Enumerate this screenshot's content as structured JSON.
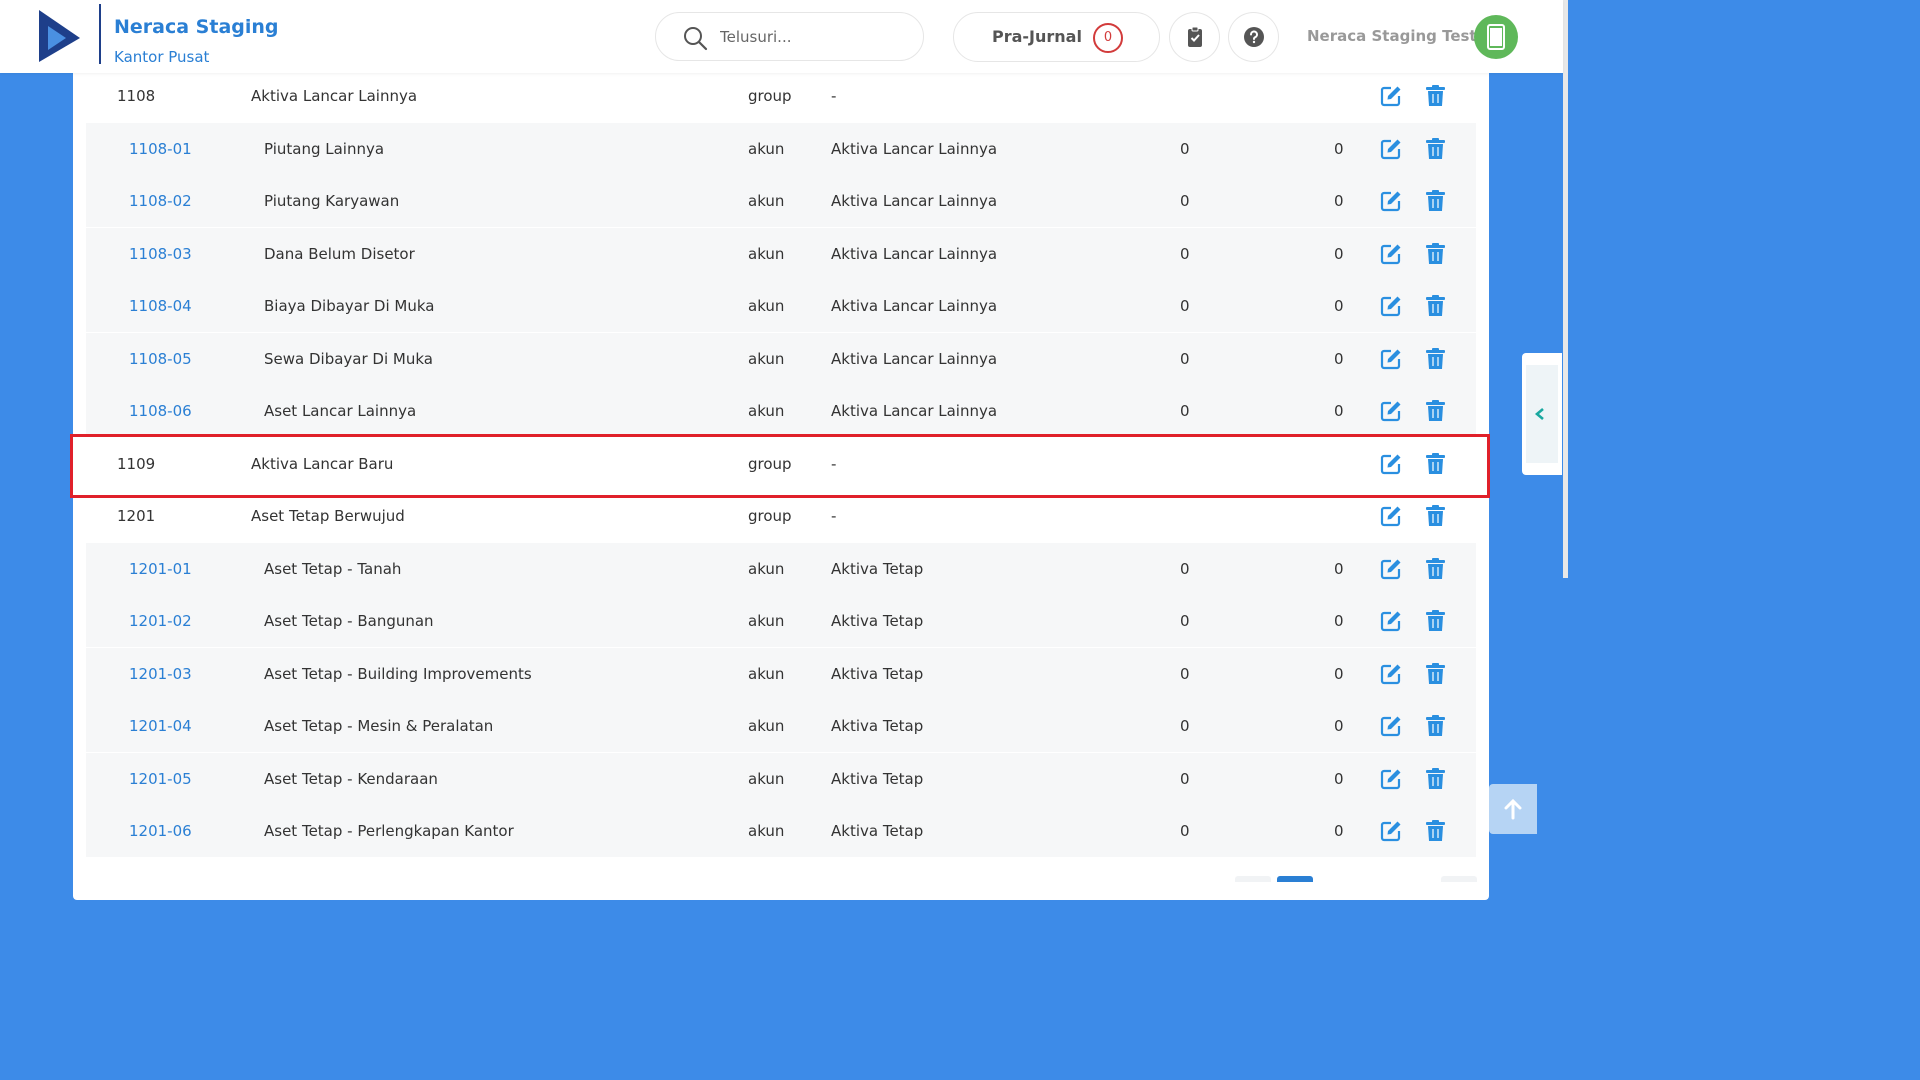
{
  "header": {
    "brand_title": "Neraca Staging",
    "brand_subtitle": "Kantor Pusat",
    "search_placeholder": "Telusuri...",
    "pra_jurnal_label": "Pra-Jurnal",
    "pra_jurnal_count": "0",
    "user_name": "Neraca Staging Test"
  },
  "colors": {
    "brand_blue": "#2a7fd4",
    "background_blue": "#3d8be8",
    "highlight_red": "#e0202a",
    "avatar_green": "#5fb85a"
  },
  "icons": {
    "logo": "play-logo-icon",
    "search": "search-icon",
    "tasks": "clipboard-check-icon",
    "help": "question-circle-icon",
    "avatar": "mobile-phone-icon",
    "edit": "edit-icon",
    "delete": "trash-icon",
    "side_toggle": "chevron-left-icon",
    "scroll_top": "arrow-up-icon"
  },
  "rows": [
    {
      "code": "1108",
      "name": "Aktiva Lancar Lainnya",
      "type": "group",
      "parent": "-",
      "debit": "",
      "credit": ""
    },
    {
      "code": "1108-01",
      "name": "Piutang Lainnya",
      "type": "akun",
      "parent": "Aktiva Lancar Lainnya",
      "debit": "0",
      "credit": "0"
    },
    {
      "code": "1108-02",
      "name": "Piutang Karyawan",
      "type": "akun",
      "parent": "Aktiva Lancar Lainnya",
      "debit": "0",
      "credit": "0"
    },
    {
      "code": "1108-03",
      "name": "Dana Belum Disetor",
      "type": "akun",
      "parent": "Aktiva Lancar Lainnya",
      "debit": "0",
      "credit": "0"
    },
    {
      "code": "1108-04",
      "name": "Biaya Dibayar Di Muka",
      "type": "akun",
      "parent": "Aktiva Lancar Lainnya",
      "debit": "0",
      "credit": "0"
    },
    {
      "code": "1108-05",
      "name": "Sewa Dibayar Di Muka",
      "type": "akun",
      "parent": "Aktiva Lancar Lainnya",
      "debit": "0",
      "credit": "0"
    },
    {
      "code": "1108-06",
      "name": "Aset Lancar Lainnya",
      "type": "akun",
      "parent": "Aktiva Lancar Lainnya",
      "debit": "0",
      "credit": "0"
    },
    {
      "code": "1109",
      "name": "Aktiva Lancar Baru",
      "type": "group",
      "parent": "-",
      "debit": "",
      "credit": ""
    },
    {
      "code": "1201",
      "name": "Aset Tetap Berwujud",
      "type": "group",
      "parent": "-",
      "debit": "",
      "credit": ""
    },
    {
      "code": "1201-01",
      "name": "Aset Tetap - Tanah",
      "type": "akun",
      "parent": "Aktiva Tetap",
      "debit": "0",
      "credit": "0"
    },
    {
      "code": "1201-02",
      "name": "Aset Tetap - Bangunan",
      "type": "akun",
      "parent": "Aktiva Tetap",
      "debit": "0",
      "credit": "0"
    },
    {
      "code": "1201-03",
      "name": "Aset Tetap - Building Improvements",
      "type": "akun",
      "parent": "Aktiva Tetap",
      "debit": "0",
      "credit": "0"
    },
    {
      "code": "1201-04",
      "name": "Aset Tetap - Mesin & Peralatan",
      "type": "akun",
      "parent": "Aktiva Tetap",
      "debit": "0",
      "credit": "0"
    },
    {
      "code": "1201-05",
      "name": "Aset Tetap - Kendaraan",
      "type": "akun",
      "parent": "Aktiva Tetap",
      "debit": "0",
      "credit": "0"
    },
    {
      "code": "1201-06",
      "name": "Aset Tetap - Perlengkapan Kantor",
      "type": "akun",
      "parent": "Aktiva Tetap",
      "debit": "0",
      "credit": "0"
    }
  ]
}
